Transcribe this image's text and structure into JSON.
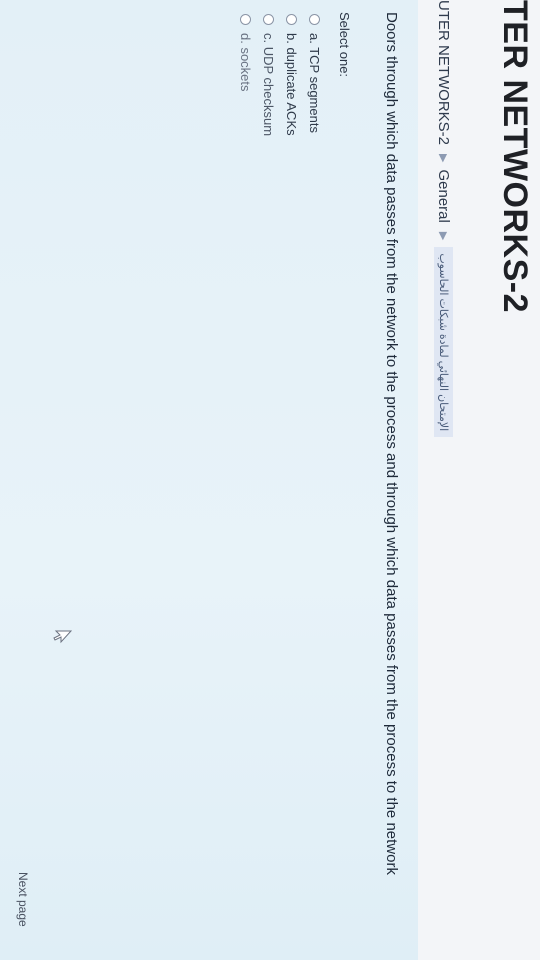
{
  "page": {
    "title": "TER NETWORKS-2"
  },
  "breadcrumb": {
    "course": "UTER NETWORKS-2",
    "section": "General",
    "quiz": "الإمتحان النهائي لمادة شبكات الحاسوب"
  },
  "question": {
    "text": "Doors through which data passes from the network to the process and through which data passes from the process to the network",
    "prompt": "Select one:",
    "options": [
      {
        "label": "a. TCP segments"
      },
      {
        "label": "b. duplicate ACKs"
      },
      {
        "label": "c. UDP checksum"
      },
      {
        "label": "d. sockets"
      }
    ]
  },
  "navigation": {
    "next_label": "Next page"
  },
  "icons": {
    "breadcrumb_separator": "triangle-right-icon",
    "pointer": "mouse-cursor-icon"
  },
  "colors": {
    "question_panel": "#e3f0f7",
    "breadcrumb_highlight": "#dfe6f3",
    "title_text": "#1f2126"
  }
}
